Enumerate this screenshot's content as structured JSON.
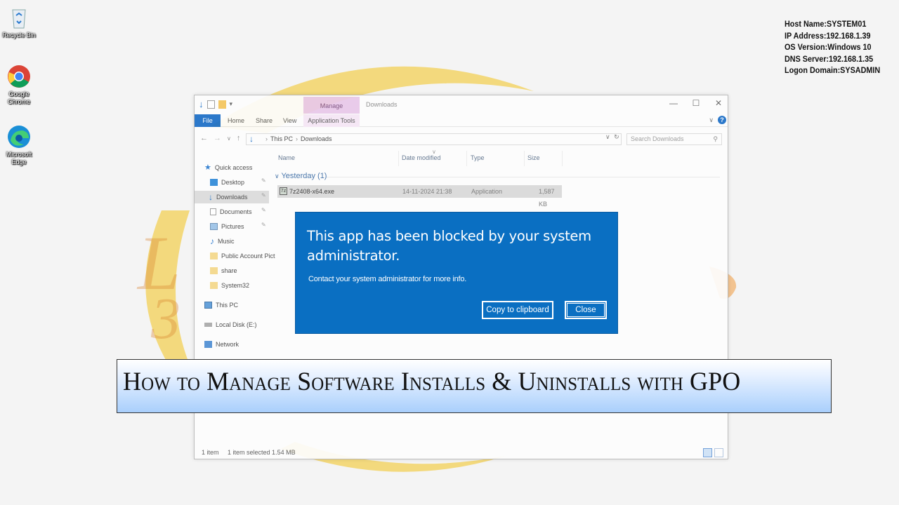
{
  "desktop": {
    "icons": [
      {
        "label": "Recycle Bin",
        "icon": "recycle-bin-icon"
      },
      {
        "label": "Google Chrome",
        "icon": "chrome-icon"
      },
      {
        "label": "Microsoft Edge",
        "icon": "edge-icon"
      }
    ]
  },
  "bginfo": {
    "host": "Host Name:SYSTEM01",
    "ip": "IP Address:192.168.1.39",
    "os": "OS Version:Windows 10",
    "dns": "DNS Server:192.168.1.35",
    "domain": "Logon Domain:SYSADMIN"
  },
  "explorer": {
    "title": "Downloads",
    "manage_tab": "Manage",
    "ribbon": {
      "file": "File",
      "home": "Home",
      "share": "Share",
      "view": "View",
      "app_tools": "Application Tools"
    },
    "address": {
      "root": "This PC",
      "folder": "Downloads"
    },
    "search_placeholder": "Search Downloads",
    "nav": {
      "quick_access": "Quick access",
      "desktop": "Desktop",
      "downloads": "Downloads",
      "documents": "Documents",
      "pictures": "Pictures",
      "music": "Music",
      "public_account": "Public Account Pict",
      "share": "share",
      "system32": "System32",
      "this_pc": "This PC",
      "local_disk": "Local Disk (E:)",
      "network": "Network"
    },
    "columns": {
      "name": "Name",
      "date_modified": "Date modified",
      "type": "Type",
      "size": "Size"
    },
    "group": "Yesterday (1)",
    "file": {
      "name": "7z2408-x64.exe",
      "date": "14-11-2024 21:38",
      "type": "Application",
      "size": "1,587 KB"
    },
    "status": {
      "count": "1 item",
      "selected": "1 item selected  1.54 MB"
    }
  },
  "dialog": {
    "headline": "This app has been blocked by your system administrator.",
    "message": "Contact your system administrator for more info.",
    "copy_button": "Copy to clipboard",
    "close_button": "Close",
    "color": "#0a6fc2"
  },
  "banner": {
    "title": "How to Manage Software Installs & Uninstalls with GPO"
  }
}
